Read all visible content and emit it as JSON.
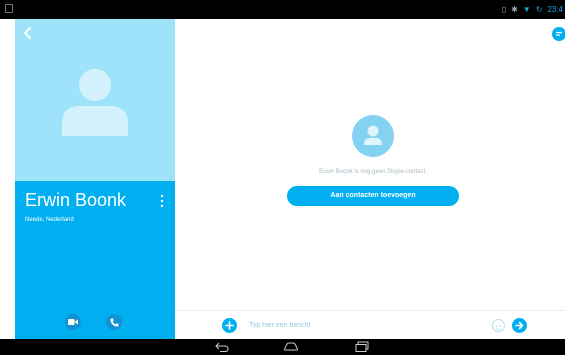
{
  "status_bar": {
    "time": "23:4",
    "icons": [
      "battery-icon",
      "bluetooth-icon",
      "wifi-icon",
      "sync-icon"
    ]
  },
  "contact": {
    "name": "Erwin Boonk",
    "location": "Neede, Nederland"
  },
  "main": {
    "info": "Erwin Boonk is nog geen Skype-contact.",
    "add_button": "Aan contacten toevoegen"
  },
  "composer": {
    "placeholder": "Typ hier een bericht"
  },
  "colors": {
    "accent": "#00aff0",
    "avatar_bg": "#9fe3fb",
    "dark_button": "#1591d3"
  },
  "nav": [
    "back-icon",
    "home-icon",
    "recents-icon"
  ]
}
